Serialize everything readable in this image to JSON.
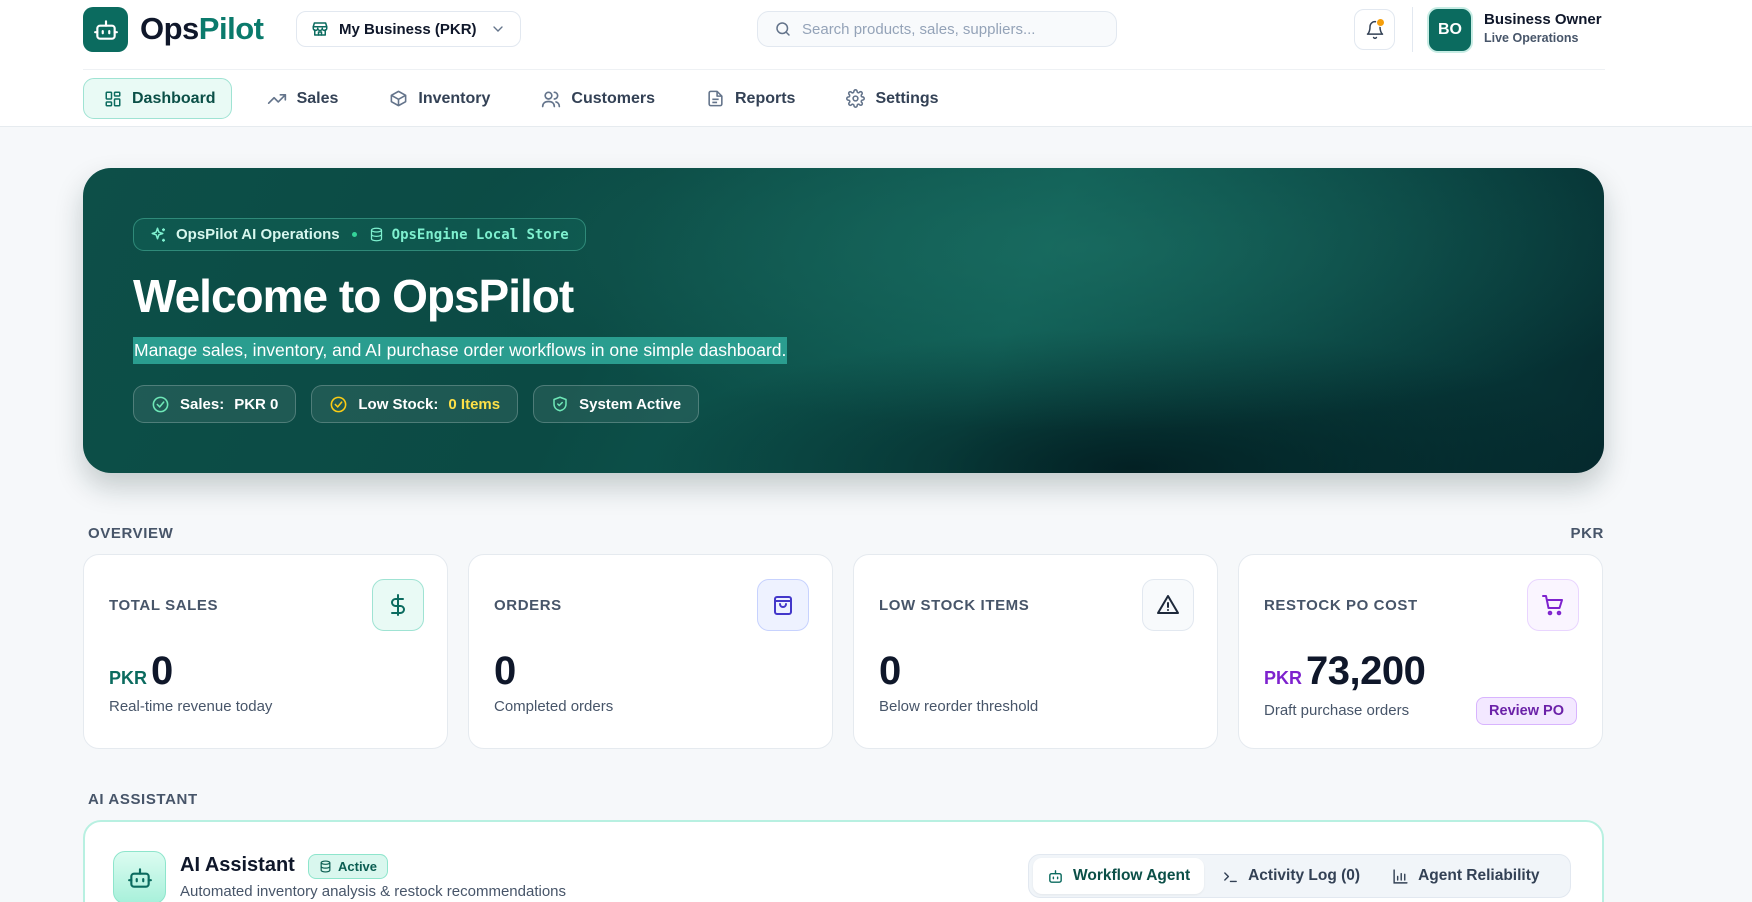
{
  "app": {
    "name_part1": "Ops",
    "name_part2": "Pilot",
    "business_selector": "My Business (PKR)",
    "search_placeholder": "Search products, sales, suppliers...",
    "user": {
      "initials": "BO",
      "name": "Business Owner",
      "role": "Live Operations"
    }
  },
  "nav": [
    {
      "label": "Dashboard",
      "icon": "dashboard-grid-icon",
      "active": true
    },
    {
      "label": "Sales",
      "icon": "trending-up-icon",
      "active": false
    },
    {
      "label": "Inventory",
      "icon": "box-icon",
      "active": false
    },
    {
      "label": "Customers",
      "icon": "users-icon",
      "active": false
    },
    {
      "label": "Reports",
      "icon": "document-icon",
      "active": false
    },
    {
      "label": "Settings",
      "icon": "gear-icon",
      "active": false
    }
  ],
  "hero": {
    "chip_label": "OpsPilot AI Operations",
    "chip_store": "OpsEngine Local Store",
    "title": "Welcome to OpsPilot",
    "subtitle": "Manage sales, inventory, and AI purchase order workflows in one simple dashboard.",
    "pills": {
      "sales_label": "Sales:",
      "sales_value": "PKR 0",
      "low_stock_label": "Low Stock:",
      "low_stock_value": "0 Items",
      "system_label": "System Active"
    }
  },
  "overview": {
    "label": "OVERVIEW",
    "currency": "PKR",
    "cards": [
      {
        "title": "TOTAL SALES",
        "prefix": "PKR",
        "value": "0",
        "desc": "Real-time revenue today",
        "icon": "dollar-icon"
      },
      {
        "title": "ORDERS",
        "value": "0",
        "desc": "Completed orders",
        "icon": "shopping-bag-icon"
      },
      {
        "title": "LOW STOCK ITEMS",
        "value": "0",
        "desc": "Below reorder threshold",
        "icon": "warning-triangle-icon"
      },
      {
        "title": "RESTOCK PO COST",
        "prefix": "PKR",
        "value": "73,200",
        "desc": "Draft purchase orders",
        "action": "Review PO",
        "icon": "cart-icon"
      }
    ]
  },
  "ai": {
    "section_label": "AI ASSISTANT",
    "title": "AI Assistant",
    "badge": "Active",
    "desc": "Automated inventory analysis & restock recommendations",
    "tabs": [
      {
        "label": "Workflow Agent",
        "active": true
      },
      {
        "label": "Activity Log (0)",
        "active": false
      },
      {
        "label": "Agent Reliability",
        "active": false
      }
    ]
  },
  "colors": {
    "brand": "#0b6b5f",
    "brand_light": "#e9faf5",
    "warning": "#f59e0b",
    "purple": "#7e22ce"
  }
}
